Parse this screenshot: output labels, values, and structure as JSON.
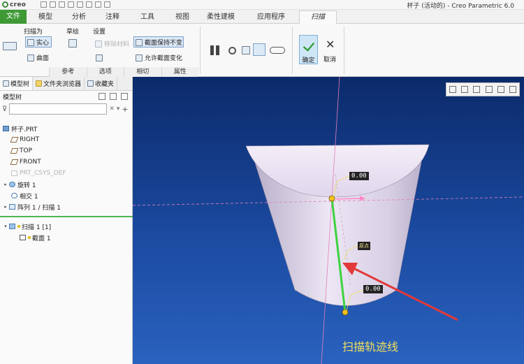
{
  "app": {
    "logo": "creo",
    "window_title": "杯子 (活动的) - Creo Parametric 6.0"
  },
  "tabs": [
    {
      "label": "文件"
    },
    {
      "label": "模型"
    },
    {
      "label": "分析"
    },
    {
      "label": "注释"
    },
    {
      "label": "工具"
    },
    {
      "label": "视图"
    },
    {
      "label": "柔性建模"
    },
    {
      "label": "应用程序"
    },
    {
      "label": "扫描"
    }
  ],
  "ribbon": {
    "sweep_as": {
      "label": "扫描为",
      "solid": "实心",
      "surface": "曲面"
    },
    "sketch_label": "草绘",
    "settings": {
      "label": "设置",
      "remove_material": "移除材料",
      "keep_section": "截面保持不变",
      "allow_section_change": "允许截面变化"
    },
    "groups": [
      "参考",
      "选项",
      "相切",
      "属性"
    ],
    "confirm": "确定",
    "cancel": "取消"
  },
  "left_panel": {
    "tabs": [
      "模型树",
      "文件夹浏览器",
      "收藏夹"
    ],
    "header": "模型树",
    "tree": [
      {
        "label": "杯子.PRT"
      },
      {
        "label": "RIGHT"
      },
      {
        "label": "TOP"
      },
      {
        "label": "FRONT"
      },
      {
        "label": "PRT_CSYS_DEF"
      },
      {
        "label": "旋转 1"
      },
      {
        "label": "相交 1"
      },
      {
        "label": "阵列 1 / 扫描 1"
      },
      {
        "label": "扫描 1 [1]"
      },
      {
        "label": "截面 1"
      }
    ]
  },
  "viewport": {
    "dim_top": "0.00",
    "dim_bottom": "0.00",
    "origin_tag": "原点",
    "caption": "扫描轨迹线"
  },
  "colors": {
    "file_tab": "#3f9a36",
    "trajectory": "#3fd23f",
    "arrow": "#e23a3a",
    "caption": "#f0e05a"
  }
}
